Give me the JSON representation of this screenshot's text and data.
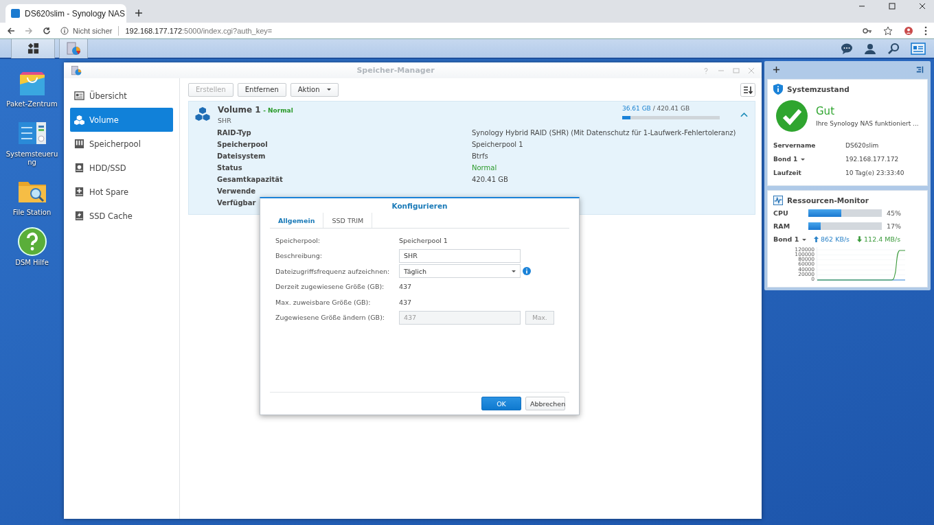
{
  "browser": {
    "tab_title": "DS620slim - Synology NAS",
    "security": "Nicht sicher",
    "url_host": "192.168.177.172",
    "url_rest": ":5000/index.cgi?auth_key="
  },
  "desktop_icons": [
    {
      "kind": "package",
      "label": "Paket-Zentrum"
    },
    {
      "kind": "control",
      "label": "Systemsteuerung"
    },
    {
      "kind": "folder",
      "label": "File Station"
    },
    {
      "kind": "help",
      "label": "DSM Hilfe"
    }
  ],
  "window": {
    "title": "Speicher-Manager",
    "toolbar": [
      {
        "label": "Erstellen",
        "disabled": true,
        "dropdown": false
      },
      {
        "label": "Entfernen",
        "disabled": false,
        "dropdown": false
      },
      {
        "label": "Aktion",
        "disabled": false,
        "dropdown": true
      }
    ],
    "sidebar": [
      {
        "kind": "overview",
        "label": "Übersicht",
        "selected": false
      },
      {
        "kind": "volume",
        "label": "Volume",
        "selected": true
      },
      {
        "kind": "pool",
        "label": "Speicherpool",
        "selected": false
      },
      {
        "kind": "disk",
        "label": "HDD/SSD",
        "selected": false
      },
      {
        "kind": "spare",
        "label": "Hot Spare",
        "selected": false
      },
      {
        "kind": "cache",
        "label": "SSD Cache",
        "selected": false
      }
    ],
    "volume": {
      "name": "Volume 1",
      "status": "- Normal",
      "subtitle": "SHR",
      "used": "36.61 GB",
      "total": "/ 420.41 GB",
      "level": 0.087,
      "expanded": true,
      "details": [
        {
          "kind": "text",
          "label": "RAID-Typ",
          "value": "Synology Hybrid RAID (SHR) (Mit Datenschutz für 1-Laufwerk-Fehlertoleranz)"
        },
        {
          "kind": "text",
          "label": "Speicherpool",
          "value": "Speicherpool 1"
        },
        {
          "kind": "text",
          "label": "Dateisystem",
          "value": "Btrfs"
        },
        {
          "kind": "status",
          "label": "Status",
          "value": "Normal"
        },
        {
          "kind": "text",
          "label": "Gesamtkapazität",
          "value": "420.41 GB"
        },
        {
          "label": "Verwende"
        },
        {
          "label": "Verfügbar"
        }
      ]
    }
  },
  "dialog": {
    "title": "Konfigurieren",
    "tabs": [
      {
        "label": "Allgemein",
        "selected": true
      },
      {
        "label": "SSD TRIM",
        "selected": false
      }
    ],
    "fields": [
      {
        "kind": "text",
        "label": "Speicherpool:",
        "value": "Speicherpool 1"
      },
      {
        "kind": "input",
        "label": "Beschreibung:",
        "value": "SHR"
      },
      {
        "kind": "select",
        "label": "Dateizugriffsfrequenz aufzeichnen:",
        "value": "Täglich"
      },
      {
        "kind": "text",
        "label": "Derzeit zugewiesene Größe (GB):",
        "value": "437"
      },
      {
        "kind": "text",
        "label": "Max. zuweisbare Größe (GB):",
        "value": "437"
      },
      {
        "kind": "disabled_input",
        "label": "Zugewiesene Größe ändern (GB):",
        "value": "437",
        "button": "Max."
      }
    ],
    "buttons": [
      {
        "label": "OK",
        "primary": true
      },
      {
        "label": "Abbrechen",
        "primary": false
      }
    ]
  },
  "system_health": {
    "title": "Systemzustand",
    "status": "Gut",
    "message": "Ihre Synology NAS funktioniert ...",
    "rows": [
      {
        "label": "Servername",
        "value": "DS620slim",
        "dropdown": false
      },
      {
        "label": "Bond 1",
        "value": "192.168.177.172",
        "dropdown": true
      },
      {
        "label": "Laufzeit",
        "value": "10 Tag(e) 23:33:40",
        "dropdown": false
      }
    ]
  },
  "resource_monitor": {
    "title": "Ressourcen-Monitor",
    "meters": [
      {
        "label": "CPU",
        "level": 0.45,
        "reading": "45%"
      },
      {
        "label": "RAM",
        "level": 0.17,
        "reading": "17%"
      }
    ],
    "network": "Bond 1",
    "upload": "862 KB/s",
    "download": "112.4 MB/s",
    "chart_axis_labels": [
      "120000",
      "100000",
      "80000",
      "60000",
      "40000",
      "20000",
      "0"
    ]
  }
}
